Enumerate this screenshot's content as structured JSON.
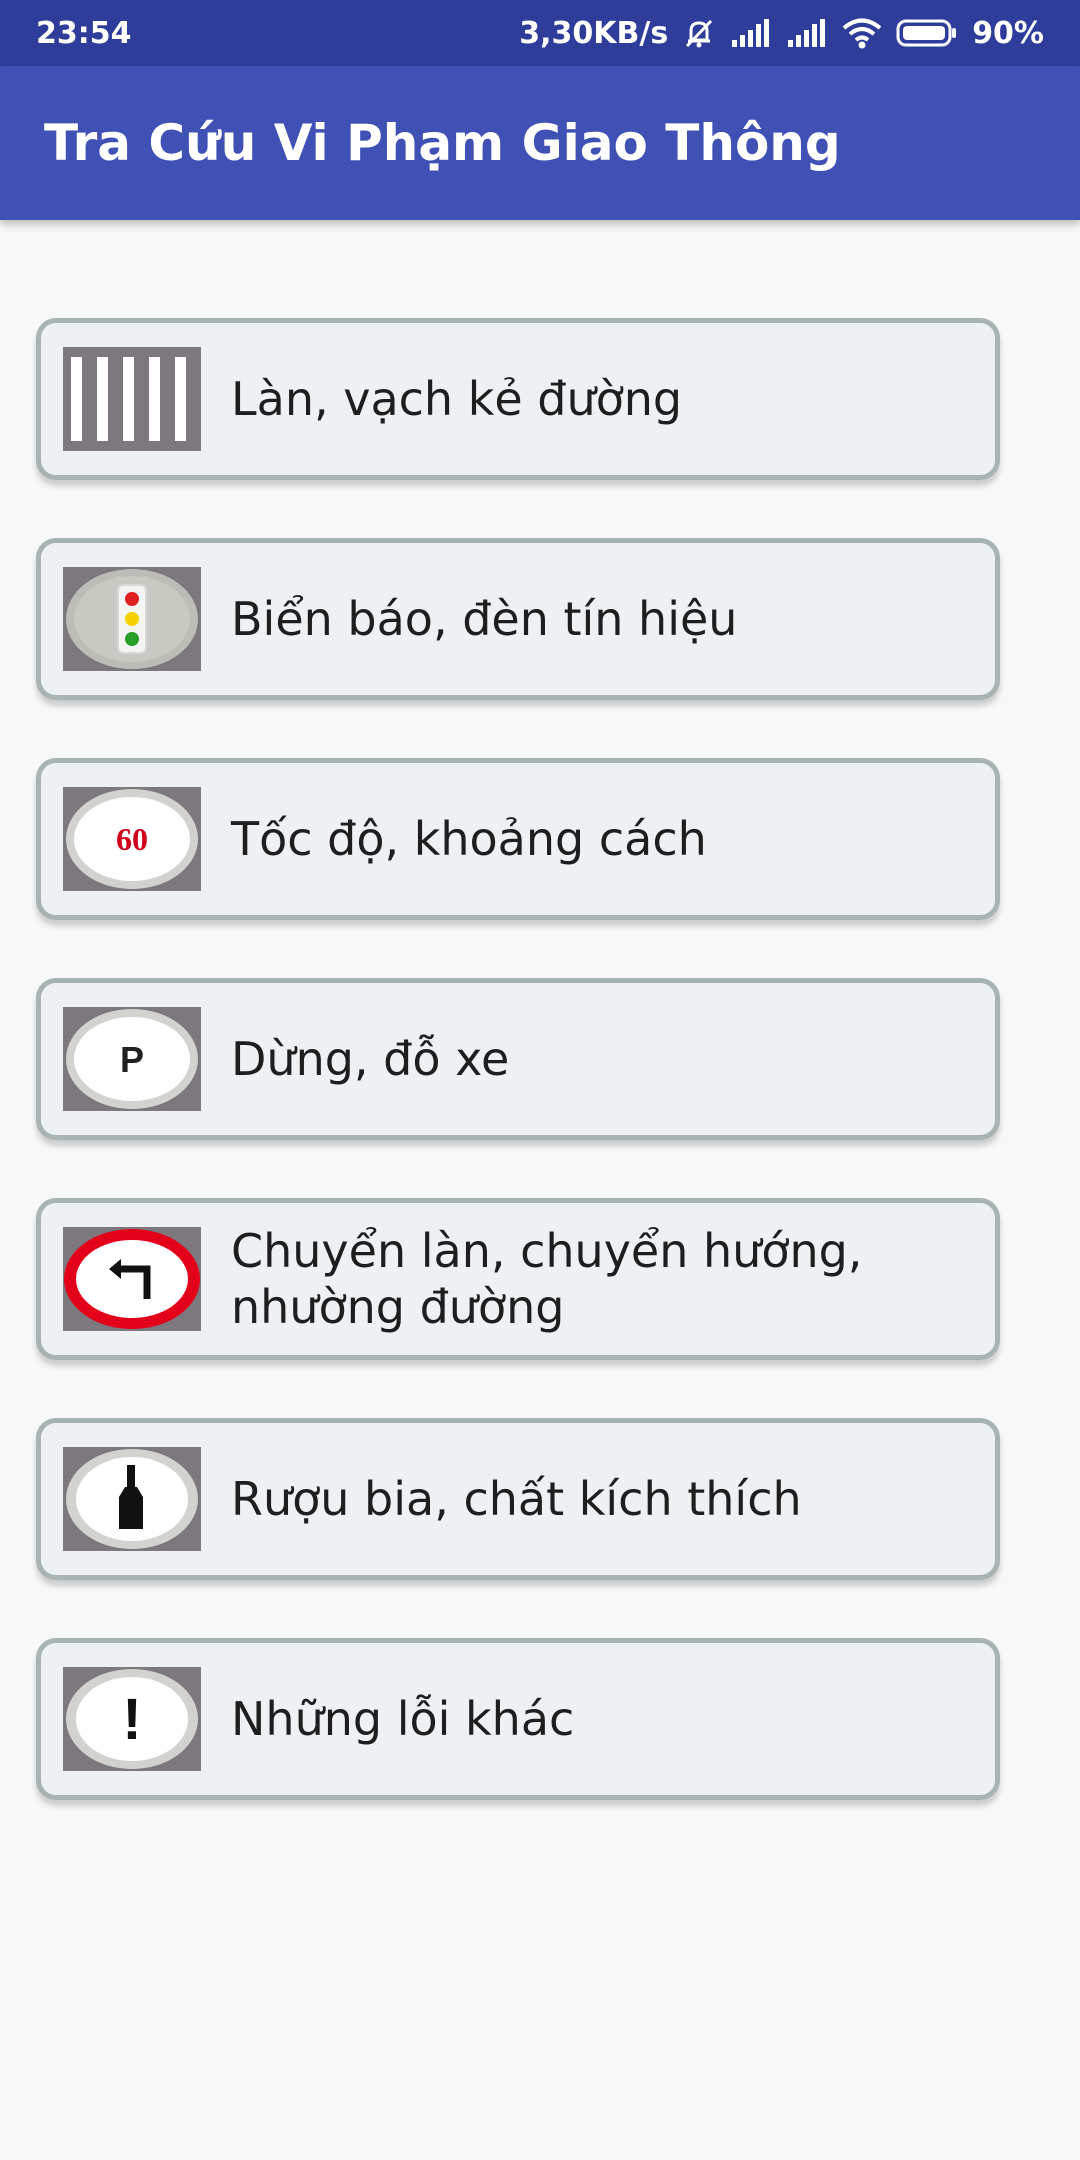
{
  "status_bar": {
    "time": "23:54",
    "network_speed": "3,30KB/s",
    "battery": "90%",
    "icons": [
      "mute-bell-icon",
      "signal-icon",
      "signal-icon",
      "wifi-icon",
      "battery-icon"
    ]
  },
  "app_bar": {
    "title": "Tra Cứu Vi Phạm Giao Thông"
  },
  "menu": {
    "items": [
      {
        "label": "Làn, vạch kẻ đường",
        "icon": "crosswalk-icon"
      },
      {
        "label": "Biển báo, đèn tín hiệu",
        "icon": "traffic-light-icon"
      },
      {
        "label": "Tốc độ, khoảng cách",
        "icon": "speed-limit-icon",
        "icon_text": "60"
      },
      {
        "label": "Dừng, đỗ xe",
        "icon": "parking-icon",
        "icon_text": "P"
      },
      {
        "label": "Chuyển làn, chuyển hướng, nhường đường",
        "icon": "turn-left-icon"
      },
      {
        "label": "Rượu bia, chất kích thích",
        "icon": "bottle-icon"
      },
      {
        "label": "Những lỗi khác",
        "icon": "warning-icon",
        "icon_text": "!"
      }
    ]
  },
  "colors": {
    "status_bar": "#2e3d99",
    "app_bar": "#3f51b5",
    "card_background": "#eef1f4",
    "card_border": "#a8b3b3",
    "speed_digits": "#d0021b",
    "prohibition_ring": "#e3001b"
  }
}
